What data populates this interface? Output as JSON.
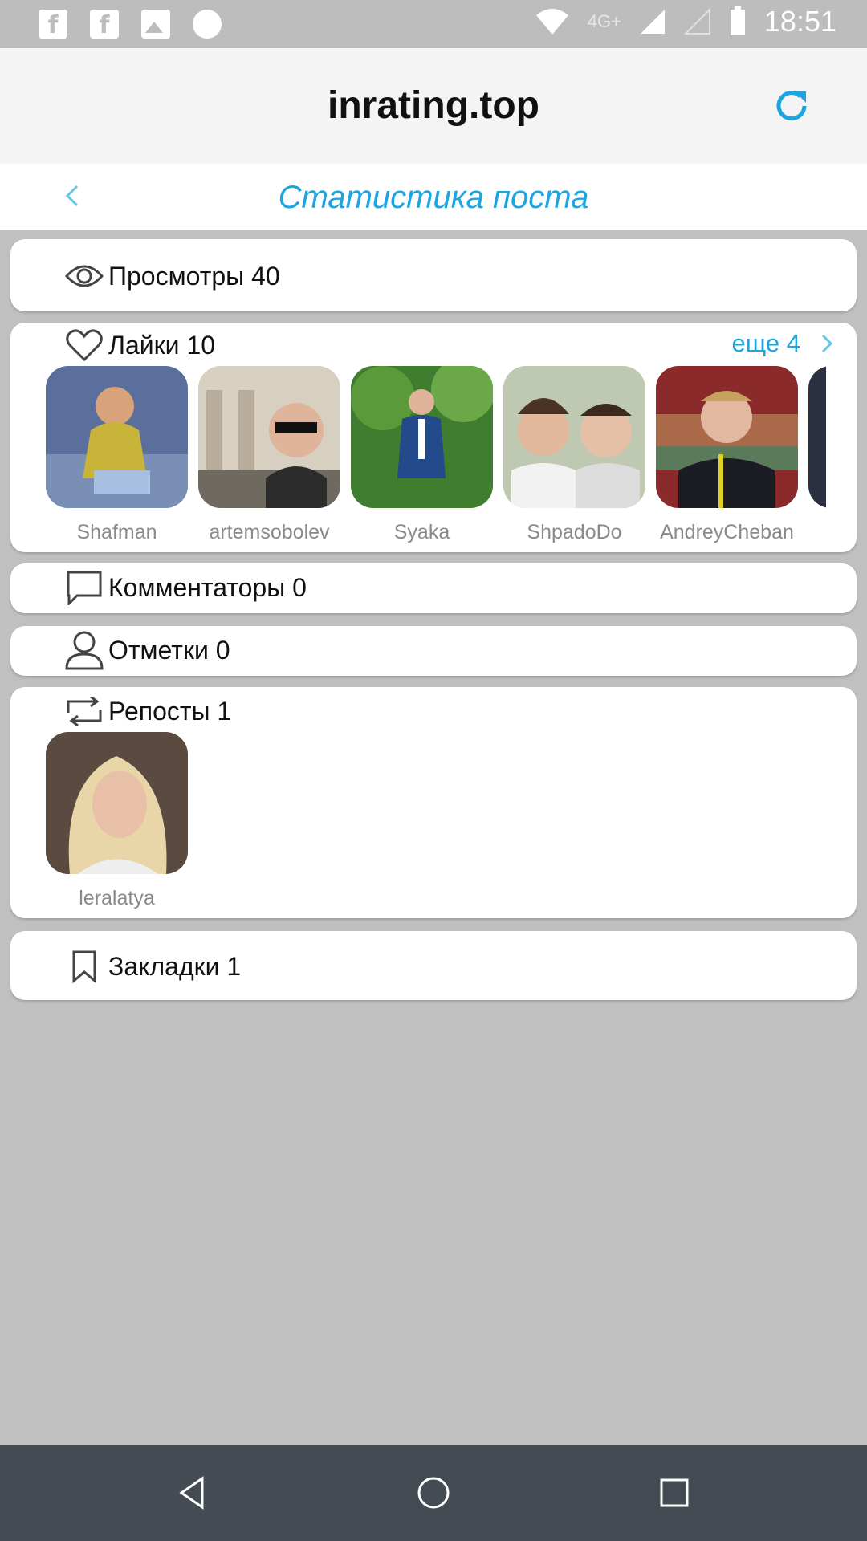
{
  "status_bar": {
    "time": "18:51",
    "network": "4G+",
    "icons": [
      "facebook-icon",
      "facebook-icon",
      "image-icon",
      "loading-icon",
      "wifi-icon",
      "signal-icon",
      "signal-icon",
      "battery-icon"
    ]
  },
  "header": {
    "title": "inrating.top",
    "refresh_icon": "refresh-icon"
  },
  "subheader": {
    "title": "Статистика поста",
    "back_icon": "chevron-left-icon"
  },
  "accent_color": "#1ea5e0",
  "cards": {
    "views": {
      "label": "Просмотры 40",
      "icon": "eye-icon"
    },
    "likes": {
      "label": "Лайки 10",
      "icon": "heart-icon",
      "more_label": "еще 4",
      "users": [
        {
          "name": "Shafman"
        },
        {
          "name": "artemsobolev"
        },
        {
          "name": "Syaka"
        },
        {
          "name": "ShpadoDo"
        },
        {
          "name": "AndreyCheban"
        }
      ]
    },
    "commenters": {
      "label": "Комментаторы 0",
      "icon": "comment-icon"
    },
    "tags": {
      "label": "Отметки 0",
      "icon": "person-icon"
    },
    "reposts": {
      "label": "Репосты 1",
      "icon": "repost-icon",
      "users": [
        {
          "name": "leralatya"
        }
      ]
    },
    "bookmarks": {
      "label": "Закладки 1",
      "icon": "bookmark-icon"
    }
  },
  "nav_bar": {
    "back": "nav-back-icon",
    "home": "nav-home-icon",
    "recents": "nav-recents-icon"
  }
}
